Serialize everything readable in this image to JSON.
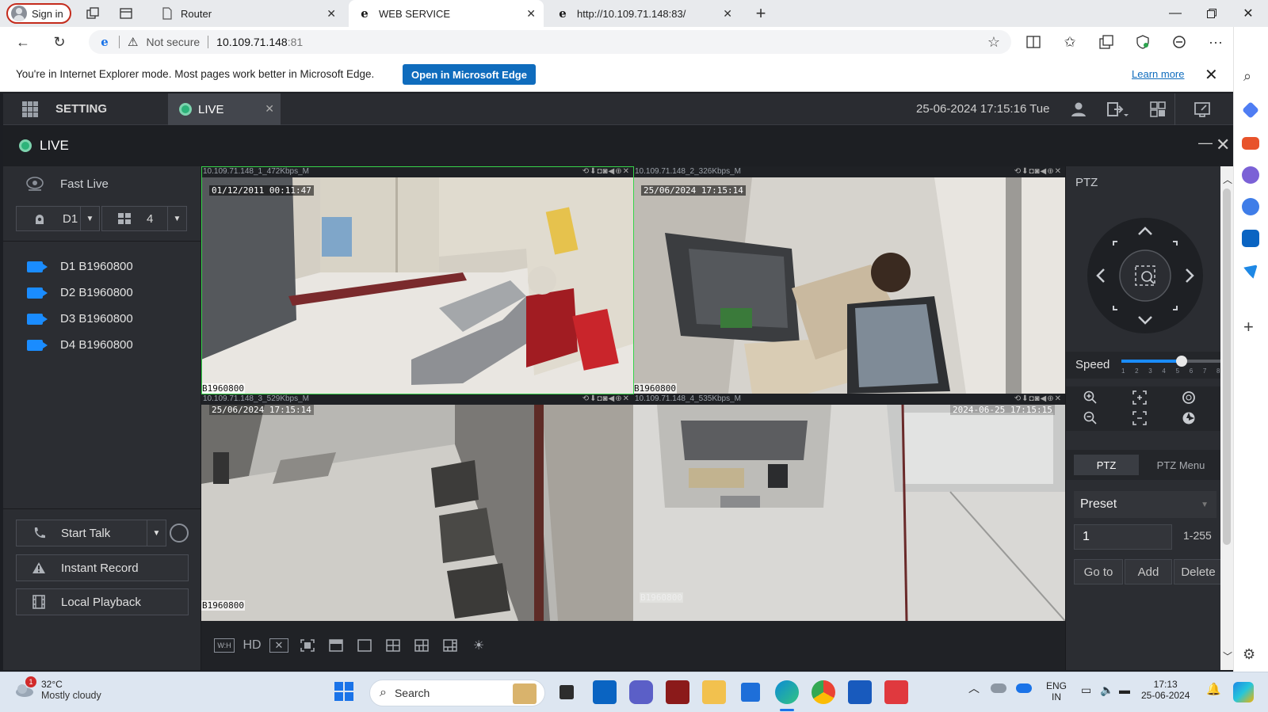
{
  "browser": {
    "signin_label": "Sign in",
    "tabs": [
      {
        "label": "Router"
      },
      {
        "label": "WEB SERVICE"
      },
      {
        "label": "http://10.109.71.148:83/"
      }
    ],
    "address": {
      "security": "Not secure",
      "host": "10.109.71.148",
      "port": ":81"
    },
    "ie_mode": {
      "message": "You're in Internet Explorer mode. Most pages work better in Microsoft Edge.",
      "open_button": "Open in Microsoft Edge",
      "learn_more": "Learn more"
    }
  },
  "app": {
    "setting_label": "SETTING",
    "live_tab_label": "LIVE",
    "datetime": "25-06-2024 17:15:16 Tue",
    "live_title": "LIVE",
    "fast_live_label": "Fast Live",
    "device_select": "D1",
    "split_select": "4",
    "devices": [
      {
        "label": "D1 B1960800"
      },
      {
        "label": "D2 B1960800"
      },
      {
        "label": "D3 B1960800"
      },
      {
        "label": "D4 B1960800"
      }
    ],
    "start_talk_label": "Start Talk",
    "instant_record_label": "Instant Record",
    "local_playback_label": "Local Playback",
    "cells": [
      {
        "header": "10.109.71.148_1_472Kbps_M",
        "osd_time": "01/12/2011 00:11:47",
        "osd_name": "B1960800"
      },
      {
        "header": "10.109.71.148_2_326Kbps_M",
        "osd_time": "25/06/2024 17:15:14",
        "osd_name": "B1960800"
      },
      {
        "header": "10.109.71.148_3_529Kbps_M",
        "osd_time": "25/06/2024 17:15:14",
        "osd_name": "B1960800"
      },
      {
        "header": "10.109.71.148_4_535Kbps_M",
        "osd_time": "2024-06-25 17:15:15",
        "osd_name": "B1960800"
      }
    ],
    "toolbar": {
      "wh_label": "W:H",
      "hd_label": "HD"
    },
    "ptz": {
      "title": "PTZ",
      "speed_label": "Speed",
      "speed_ticks": [
        "1",
        "2",
        "3",
        "4",
        "5",
        "6",
        "7",
        "8"
      ],
      "speed_value": 5,
      "tab_ptz": "PTZ",
      "tab_menu": "PTZ Menu",
      "preset_label": "Preset",
      "preset_value": "1",
      "preset_range": "1-255",
      "goto_label": "Go to",
      "add_label": "Add",
      "delete_label": "Delete"
    }
  },
  "taskbar": {
    "weather_temp": "32°C",
    "weather_desc": "Mostly cloudy",
    "weather_badge": "1",
    "search_label": "Search",
    "lang_line1": "ENG",
    "lang_line2": "IN",
    "time": "17:13",
    "date": "25-06-2024"
  },
  "colors": {
    "accent_blue": "#0f6cbd",
    "live_green": "#2db37a",
    "active_cell_border": "#37d44b",
    "camera_icon": "#1a8cff"
  }
}
